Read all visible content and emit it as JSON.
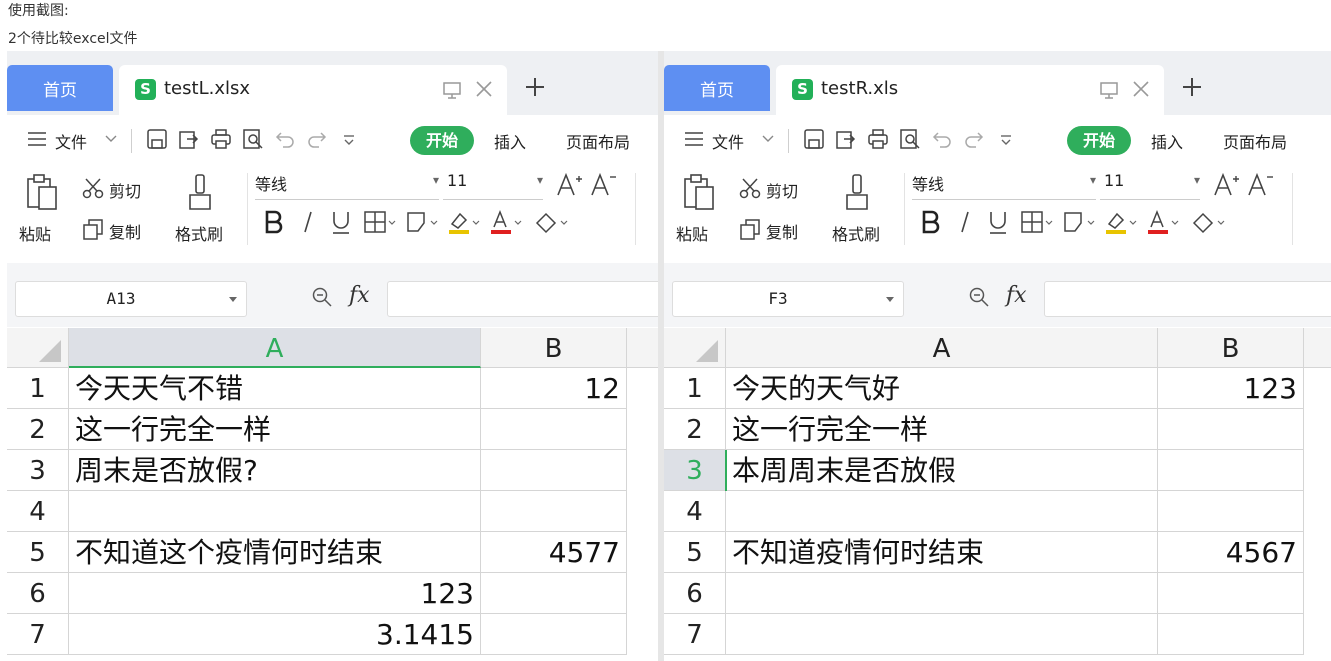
{
  "caption": {
    "line1": "使用截图:",
    "line2": "2个待比较excel文件"
  },
  "left": {
    "home_tab": "首页",
    "file_tab": "testL.xlsx",
    "menu": {
      "file": "文件",
      "start": "开始",
      "insert": "插入",
      "page_layout": "页面布局"
    },
    "ribbon": {
      "cut": "剪切",
      "paste": "粘贴",
      "copy": "复制",
      "format_painter": "格式刷",
      "font_name": "等线",
      "font_size": "11"
    },
    "name_box": "A13",
    "fx": "fx",
    "columns": [
      "A",
      "B"
    ],
    "selected_column": "A",
    "rows": [
      {
        "n": "1",
        "a": "今天天气不错",
        "b": "12"
      },
      {
        "n": "2",
        "a": "这一行完全一样",
        "b": ""
      },
      {
        "n": "3",
        "a": "周末是否放假?",
        "b": ""
      },
      {
        "n": "4",
        "a": "",
        "b": ""
      },
      {
        "n": "5",
        "a": "不知道这个疫情何时结束",
        "b": "4577"
      },
      {
        "n": "6",
        "a": "123",
        "b": "",
        "a_num": true
      },
      {
        "n": "7",
        "a": "3.1415",
        "b": "",
        "a_num": true
      }
    ]
  },
  "right": {
    "home_tab": "首页",
    "file_tab": "testR.xls",
    "menu": {
      "file": "文件",
      "start": "开始",
      "insert": "插入",
      "page_layout": "页面布局"
    },
    "ribbon": {
      "cut": "剪切",
      "paste": "粘贴",
      "copy": "复制",
      "format_painter": "格式刷",
      "font_name": "等线",
      "font_size": "11"
    },
    "name_box": "F3",
    "fx": "fx",
    "columns": [
      "A",
      "B"
    ],
    "selected_row": "3",
    "rows": [
      {
        "n": "1",
        "a": "今天的天气好",
        "b": "123"
      },
      {
        "n": "2",
        "a": "这一行完全一样",
        "b": ""
      },
      {
        "n": "3",
        "a": "本周周末是否放假",
        "b": ""
      },
      {
        "n": "4",
        "a": "",
        "b": ""
      },
      {
        "n": "5",
        "a": "不知道疫情何时结束",
        "b": "4567"
      },
      {
        "n": "6",
        "a": "",
        "b": ""
      },
      {
        "n": "7",
        "a": "",
        "b": ""
      }
    ]
  },
  "colors": {
    "accent": "#2fae5c",
    "home_tab": "#5e8ff2",
    "selected_header": "#dde0e6"
  },
  "icons": [
    "file-s-icon",
    "monitor-icon",
    "close-icon",
    "plus-icon",
    "menu-lines-icon",
    "chevron-down-icon",
    "save-icon",
    "export-icon",
    "print-icon",
    "print-preview-icon",
    "undo-icon",
    "redo-icon",
    "more-icon",
    "paste-icon",
    "scissors-icon",
    "copy-icon",
    "format-painter-icon",
    "bold-icon",
    "italic-icon",
    "underline-icon",
    "border-icon",
    "fill-icon",
    "highlight-icon",
    "font-color-icon",
    "eraser-icon",
    "font-increase-icon",
    "font-decrease-icon",
    "zoom-icon"
  ]
}
